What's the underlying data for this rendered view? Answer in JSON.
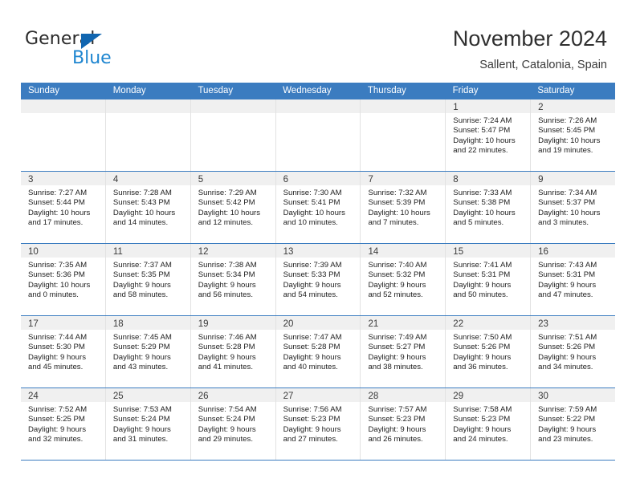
{
  "brand": {
    "name_top": "General",
    "name_bottom": "Blue",
    "accent_color": "#1f86d0",
    "triangle_color": "#1166b0"
  },
  "header": {
    "title": "November 2024",
    "subtitle": "Sallent, Catalonia, Spain"
  },
  "calendar": {
    "header_bg": "#3b7cc0",
    "header_text_color": "#ffffff",
    "weekday_headers": [
      "Sunday",
      "Monday",
      "Tuesday",
      "Wednesday",
      "Thursday",
      "Friday",
      "Saturday"
    ],
    "weeks": [
      [
        {
          "empty": true
        },
        {
          "empty": true
        },
        {
          "empty": true
        },
        {
          "empty": true
        },
        {
          "empty": true
        },
        {
          "day": "1",
          "sunrise": "Sunrise: 7:24 AM",
          "sunset": "Sunset: 5:47 PM",
          "daylight": "Daylight: 10 hours and 22 minutes."
        },
        {
          "day": "2",
          "sunrise": "Sunrise: 7:26 AM",
          "sunset": "Sunset: 5:45 PM",
          "daylight": "Daylight: 10 hours and 19 minutes."
        }
      ],
      [
        {
          "day": "3",
          "sunrise": "Sunrise: 7:27 AM",
          "sunset": "Sunset: 5:44 PM",
          "daylight": "Daylight: 10 hours and 17 minutes."
        },
        {
          "day": "4",
          "sunrise": "Sunrise: 7:28 AM",
          "sunset": "Sunset: 5:43 PM",
          "daylight": "Daylight: 10 hours and 14 minutes."
        },
        {
          "day": "5",
          "sunrise": "Sunrise: 7:29 AM",
          "sunset": "Sunset: 5:42 PM",
          "daylight": "Daylight: 10 hours and 12 minutes."
        },
        {
          "day": "6",
          "sunrise": "Sunrise: 7:30 AM",
          "sunset": "Sunset: 5:41 PM",
          "daylight": "Daylight: 10 hours and 10 minutes."
        },
        {
          "day": "7",
          "sunrise": "Sunrise: 7:32 AM",
          "sunset": "Sunset: 5:39 PM",
          "daylight": "Daylight: 10 hours and 7 minutes."
        },
        {
          "day": "8",
          "sunrise": "Sunrise: 7:33 AM",
          "sunset": "Sunset: 5:38 PM",
          "daylight": "Daylight: 10 hours and 5 minutes."
        },
        {
          "day": "9",
          "sunrise": "Sunrise: 7:34 AM",
          "sunset": "Sunset: 5:37 PM",
          "daylight": "Daylight: 10 hours and 3 minutes."
        }
      ],
      [
        {
          "day": "10",
          "sunrise": "Sunrise: 7:35 AM",
          "sunset": "Sunset: 5:36 PM",
          "daylight": "Daylight: 10 hours and 0 minutes."
        },
        {
          "day": "11",
          "sunrise": "Sunrise: 7:37 AM",
          "sunset": "Sunset: 5:35 PM",
          "daylight": "Daylight: 9 hours and 58 minutes."
        },
        {
          "day": "12",
          "sunrise": "Sunrise: 7:38 AM",
          "sunset": "Sunset: 5:34 PM",
          "daylight": "Daylight: 9 hours and 56 minutes."
        },
        {
          "day": "13",
          "sunrise": "Sunrise: 7:39 AM",
          "sunset": "Sunset: 5:33 PM",
          "daylight": "Daylight: 9 hours and 54 minutes."
        },
        {
          "day": "14",
          "sunrise": "Sunrise: 7:40 AM",
          "sunset": "Sunset: 5:32 PM",
          "daylight": "Daylight: 9 hours and 52 minutes."
        },
        {
          "day": "15",
          "sunrise": "Sunrise: 7:41 AM",
          "sunset": "Sunset: 5:31 PM",
          "daylight": "Daylight: 9 hours and 50 minutes."
        },
        {
          "day": "16",
          "sunrise": "Sunrise: 7:43 AM",
          "sunset": "Sunset: 5:31 PM",
          "daylight": "Daylight: 9 hours and 47 minutes."
        }
      ],
      [
        {
          "day": "17",
          "sunrise": "Sunrise: 7:44 AM",
          "sunset": "Sunset: 5:30 PM",
          "daylight": "Daylight: 9 hours and 45 minutes."
        },
        {
          "day": "18",
          "sunrise": "Sunrise: 7:45 AM",
          "sunset": "Sunset: 5:29 PM",
          "daylight": "Daylight: 9 hours and 43 minutes."
        },
        {
          "day": "19",
          "sunrise": "Sunrise: 7:46 AM",
          "sunset": "Sunset: 5:28 PM",
          "daylight": "Daylight: 9 hours and 41 minutes."
        },
        {
          "day": "20",
          "sunrise": "Sunrise: 7:47 AM",
          "sunset": "Sunset: 5:28 PM",
          "daylight": "Daylight: 9 hours and 40 minutes."
        },
        {
          "day": "21",
          "sunrise": "Sunrise: 7:49 AM",
          "sunset": "Sunset: 5:27 PM",
          "daylight": "Daylight: 9 hours and 38 minutes."
        },
        {
          "day": "22",
          "sunrise": "Sunrise: 7:50 AM",
          "sunset": "Sunset: 5:26 PM",
          "daylight": "Daylight: 9 hours and 36 minutes."
        },
        {
          "day": "23",
          "sunrise": "Sunrise: 7:51 AM",
          "sunset": "Sunset: 5:26 PM",
          "daylight": "Daylight: 9 hours and 34 minutes."
        }
      ],
      [
        {
          "day": "24",
          "sunrise": "Sunrise: 7:52 AM",
          "sunset": "Sunset: 5:25 PM",
          "daylight": "Daylight: 9 hours and 32 minutes."
        },
        {
          "day": "25",
          "sunrise": "Sunrise: 7:53 AM",
          "sunset": "Sunset: 5:24 PM",
          "daylight": "Daylight: 9 hours and 31 minutes."
        },
        {
          "day": "26",
          "sunrise": "Sunrise: 7:54 AM",
          "sunset": "Sunset: 5:24 PM",
          "daylight": "Daylight: 9 hours and 29 minutes."
        },
        {
          "day": "27",
          "sunrise": "Sunrise: 7:56 AM",
          "sunset": "Sunset: 5:23 PM",
          "daylight": "Daylight: 9 hours and 27 minutes."
        },
        {
          "day": "28",
          "sunrise": "Sunrise: 7:57 AM",
          "sunset": "Sunset: 5:23 PM",
          "daylight": "Daylight: 9 hours and 26 minutes."
        },
        {
          "day": "29",
          "sunrise": "Sunrise: 7:58 AM",
          "sunset": "Sunset: 5:23 PM",
          "daylight": "Daylight: 9 hours and 24 minutes."
        },
        {
          "day": "30",
          "sunrise": "Sunrise: 7:59 AM",
          "sunset": "Sunset: 5:22 PM",
          "daylight": "Daylight: 9 hours and 23 minutes."
        }
      ]
    ]
  }
}
